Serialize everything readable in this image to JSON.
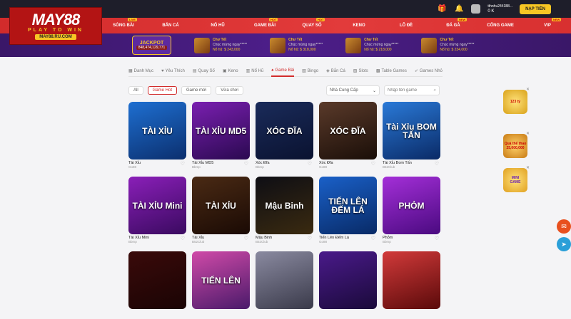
{
  "brand": {
    "line1": "MAY88",
    "line2": "PLAY TO WIN",
    "line3": "MAY88.RU.COM"
  },
  "topbar": {
    "username": "tthnhu244388...",
    "balance": "0 K",
    "deposit_label": "NẠP TIỀN"
  },
  "nav": [
    {
      "label": "SÒNG BÀI",
      "tag": "LIVE"
    },
    {
      "label": "BẮN CÁ",
      "tag": ""
    },
    {
      "label": "NỔ HŨ",
      "tag": ""
    },
    {
      "label": "GAME BÀI",
      "tag": "HOT"
    },
    {
      "label": "QUAY SỐ",
      "tag": "HOT"
    },
    {
      "label": "KENO",
      "tag": ""
    },
    {
      "label": "LÔ ĐỀ",
      "tag": ""
    },
    {
      "label": "ĐÁ GÀ",
      "tag": "NEW"
    },
    {
      "label": "CỔNG GAME",
      "tag": ""
    },
    {
      "label": "VIP",
      "tag": "NEW"
    }
  ],
  "banner": {
    "jackpot_title": "JACKPOT",
    "jackpot_value": "848,474,129,771",
    "winners": [
      {
        "title": "Chư Tết",
        "line": "Chúc mừng ngay*****",
        "amount": "Nổ hũ: $ 243,000"
      },
      {
        "title": "Chư Tết",
        "line": "Chúc mừng ngay*****",
        "amount": "Nổ hũ: $ 318,000"
      },
      {
        "title": "Chư Tết",
        "line": "Chúc mừng ngay*****",
        "amount": "Nổ hũ: $ 218,000"
      },
      {
        "title": "Chư Tết",
        "line": "Chúc mừng ngay*****",
        "amount": "Nổ hũ: $ 234,000"
      }
    ]
  },
  "categories": [
    {
      "label": "Danh Mục",
      "icon": "grid-icon"
    },
    {
      "label": "Yêu Thích",
      "icon": "heart-icon"
    },
    {
      "label": "Quay Số",
      "icon": "ticket-icon"
    },
    {
      "label": "Keno",
      "icon": "keno-icon"
    },
    {
      "label": "Nổ Hũ",
      "icon": "slot-icon"
    },
    {
      "label": "Game Bài",
      "icon": "cards-icon"
    },
    {
      "label": "Bingo",
      "icon": "bingo-icon"
    },
    {
      "label": "Bắn Cá",
      "icon": "fish-icon"
    },
    {
      "label": "Slots",
      "icon": "slots-icon"
    },
    {
      "label": "Table Games",
      "icon": "table-icon"
    },
    {
      "label": "Games Nhỏ",
      "icon": "rocket-icon"
    }
  ],
  "active_category": 5,
  "filters": {
    "buttons": [
      "All",
      "Game Hot",
      "Game mới",
      "Vừa chơi"
    ],
    "active": 1,
    "provider_label": "Nhà Cung Cấp",
    "search_placeholder": "Nhập tên game"
  },
  "games": [
    {
      "title": "TÀI XỈU",
      "name": "Tài Xỉu",
      "provider": "Go88"
    },
    {
      "title": "TÀI XỈU MD5",
      "name": "Tài Xỉu MD5",
      "provider": "Bbmp"
    },
    {
      "title": "XÓC ĐĨA",
      "name": "Xóc Đĩa",
      "provider": "Bbmp"
    },
    {
      "title": "XÓC ĐĨA",
      "name": "Xóc Đĩa",
      "provider": "Go88"
    },
    {
      "title": "Tài Xỉu BOM TẤN",
      "name": "Tài Xỉu Bom Tấn",
      "provider": "B52Club"
    },
    {
      "title": "TÀI XỈU Mini",
      "name": "Tài Xỉu Mini",
      "provider": "Bbmp"
    },
    {
      "title": "TÀI XỈU",
      "name": "Tài Xỉu",
      "provider": "B52Club"
    },
    {
      "title": "Mậu Binh",
      "name": "Mậu Binh",
      "provider": "B52Club"
    },
    {
      "title": "TIẾN LÊN ĐẾM LÁ",
      "name": "Tiến Lên Đếm Lá",
      "provider": "Go88"
    },
    {
      "title": "PHỎM",
      "name": "Phỏm",
      "provider": "Bbmp"
    },
    {
      "title": "",
      "name": "",
      "provider": ""
    },
    {
      "title": "TIẾN LÊN",
      "name": "",
      "provider": ""
    },
    {
      "title": "",
      "name": "",
      "provider": ""
    },
    {
      "title": "",
      "name": "",
      "provider": ""
    },
    {
      "title": "",
      "name": "",
      "provider": ""
    }
  ],
  "side_promos": [
    {
      "line1": "",
      "line2": "123 tỷ"
    },
    {
      "line1": "Quà thể thao",
      "line2": "25,000,000"
    },
    {
      "line1": "MINI",
      "line2": "GAME"
    }
  ]
}
